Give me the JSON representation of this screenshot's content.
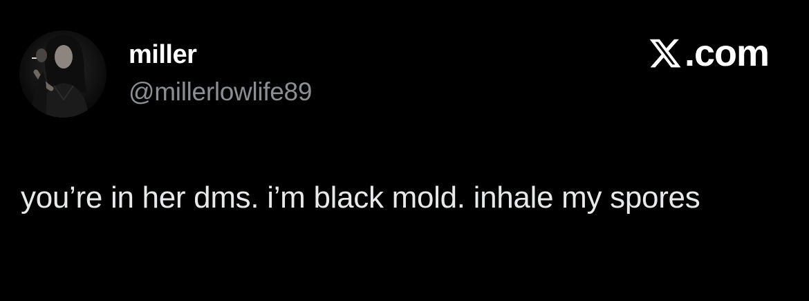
{
  "author": {
    "display_name": "miller",
    "handle": "@millerlowlife89",
    "avatar_icon": "profile-photo"
  },
  "brand": {
    "label": ".com",
    "icon": "x-logo-icon"
  },
  "tweet": {
    "text": "you’re in her dms. i’m black mold. inhale my spores"
  },
  "colors": {
    "background": "#000000",
    "name": "#ffffff",
    "handle": "#8b8f94",
    "body": "#e7e9ea"
  }
}
